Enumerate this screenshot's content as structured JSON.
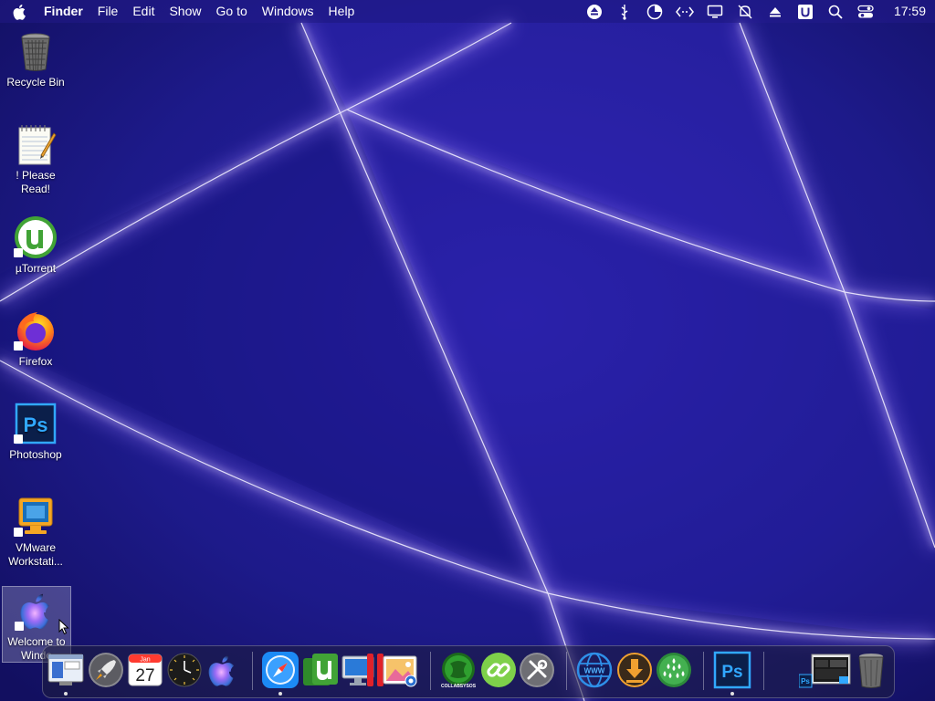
{
  "menubar": {
    "app_name": "Finder",
    "items": [
      "File",
      "Edit",
      "Show",
      "Go to",
      "Windows",
      "Help"
    ],
    "status_icons": [
      "eject-icon",
      "usb-icon",
      "pie-chart-icon",
      "network-code-icon",
      "display-icon",
      "muted-bell-icon",
      "triangle-up-icon",
      "u-badge-icon",
      "search-icon",
      "control-center-icon"
    ],
    "clock": "17:59"
  },
  "desktop": {
    "icons": [
      {
        "label": "Recycle Bin",
        "icon": "recycle-bin-icon"
      },
      {
        "label": "! Please Read!",
        "icon": "notepad-icon"
      },
      {
        "label": "µTorrent",
        "icon": "utorrent-icon"
      },
      {
        "label": "Firefox",
        "icon": "firefox-icon"
      },
      {
        "label": "Photoshop",
        "icon": "photoshop-icon"
      },
      {
        "label": "VMware Workstati...",
        "icon": "vmware-icon"
      },
      {
        "label": "Welcome to Windo",
        "icon": "apple-logo-icon"
      }
    ]
  },
  "dock": {
    "items": [
      {
        "icon": "finder-icon"
      },
      {
        "icon": "launchpad-rocket-icon"
      },
      {
        "icon": "calendar-icon",
        "month": "Jan",
        "day": "27"
      },
      {
        "icon": "clock-icon"
      },
      {
        "icon": "apple-siri-icon"
      },
      {
        "icon": "safari-icon"
      },
      {
        "icon": "utorrent-icon"
      },
      {
        "icon": "monitor-icon"
      },
      {
        "icon": "parallels-icon"
      },
      {
        "icon": "photos-icon"
      },
      {
        "icon": "collabs-icon",
        "label": "COLLABSYSOS"
      },
      {
        "icon": "link-icon"
      },
      {
        "icon": "tools-icon"
      },
      {
        "icon": "www-globe-icon",
        "label": "WWW"
      },
      {
        "icon": "download-icon"
      },
      {
        "icon": "drops-icon"
      },
      {
        "icon": "photoshop-icon",
        "label": "Ps"
      },
      {
        "icon": "window-preview-icon"
      },
      {
        "icon": "trash-icon"
      }
    ]
  },
  "colors": {
    "background": "#1c1a86",
    "light_beam": "#b9a6ff",
    "menubar_text": "#ffffff",
    "utorrent_green": "#41a336",
    "photoshop_blue": "#31a8ff",
    "safari_blue": "#1c8af5"
  }
}
